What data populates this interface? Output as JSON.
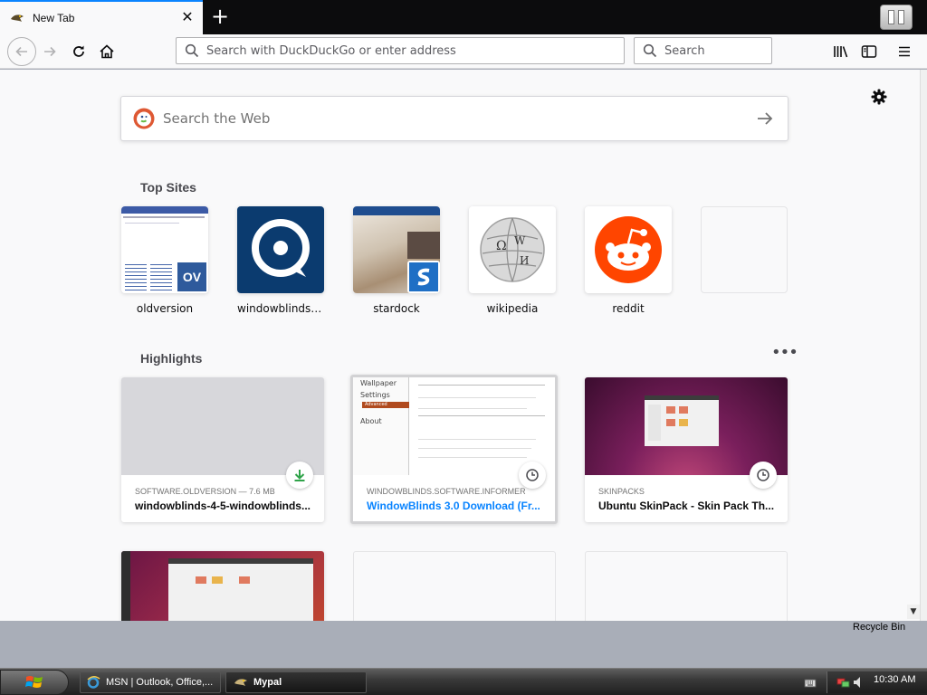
{
  "browser": {
    "tab_title": "New Tab",
    "tab_close": "✕",
    "new_tab": "+",
    "urlbar_placeholder": "Search with DuckDuckGo or enter address",
    "searchbar_placeholder": "Search"
  },
  "newtab": {
    "web_search_placeholder": "Search the Web",
    "top_sites_title": "Top Sites",
    "top_sites": [
      {
        "label": "oldversion",
        "badge": "OV"
      },
      {
        "label": "windowblinds.s..."
      },
      {
        "label": "stardock"
      },
      {
        "label": "wikipedia"
      },
      {
        "label": "reddit"
      }
    ],
    "highlights_title": "Highlights",
    "highlights_menu": "•••",
    "highlights": [
      {
        "source": "SOFTWARE.OLDVERSION — 7.6 MB",
        "title": "windowblinds-4-5-windowblinds...",
        "badge": "download-icon"
      },
      {
        "source": "WINDOWBLINDS.SOFTWARE.INFORMER",
        "title": "WindowBlinds 3.0 Download (Fr...",
        "badge": "clock-icon",
        "thumb_menu": [
          "Wallpaper",
          "Settings",
          "Advanced",
          "About"
        ]
      },
      {
        "source": "SKINPACKS",
        "title": "Ubuntu SkinPack - Skin Pack Th...",
        "badge": "clock-icon"
      }
    ],
    "colors": {
      "link_blue": "#0a84ff",
      "reddit": "#ff4500",
      "windowblinds": "#0b3b6f",
      "ddg": "#de5833"
    }
  },
  "desktop": {
    "recycle_bin": "Recycle Bin",
    "taskbar": [
      {
        "label": "MSN | Outlook, Office,..."
      },
      {
        "label": "Mypal"
      }
    ],
    "clock": "10:30 AM"
  }
}
